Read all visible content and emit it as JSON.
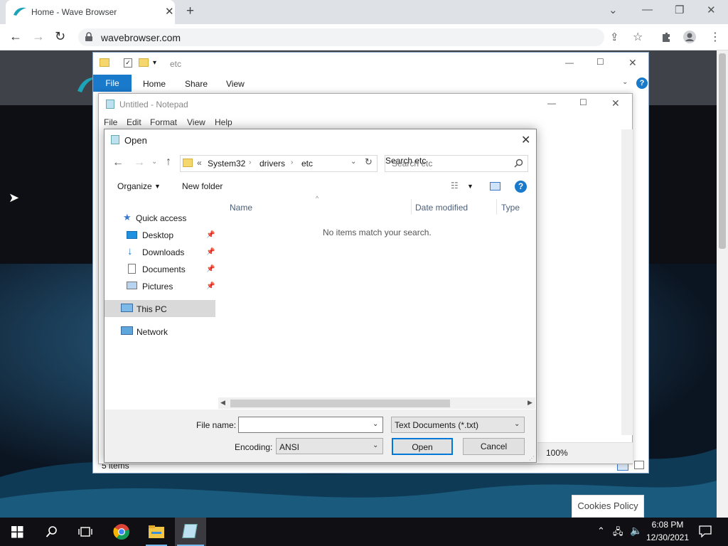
{
  "browser": {
    "tab_title": "Home - Wave Browser",
    "url": "wavebrowser.com"
  },
  "page": {
    "cookies_label": "Cookies Policy"
  },
  "explorer": {
    "title": "etc",
    "ribbon_tabs": [
      "File",
      "Home",
      "Share",
      "View"
    ],
    "status": "5 items"
  },
  "notepad": {
    "title": "Untitled - Notepad",
    "menu": [
      "File",
      "Edit",
      "Format",
      "View",
      "Help"
    ],
    "zoom": "100%"
  },
  "dialog": {
    "title": "Open",
    "breadcrumb": [
      "System32",
      "drivers",
      "etc"
    ],
    "breadcrumb_prefix": "«",
    "search_placeholder": "Search etc",
    "organize_label": "Organize",
    "new_folder_label": "New folder",
    "columns": [
      "Name",
      "Date modified",
      "Type"
    ],
    "empty_message": "No items match your search.",
    "nav": {
      "quick_access": "Quick access",
      "items": [
        "Desktop",
        "Downloads",
        "Documents",
        "Pictures"
      ],
      "this_pc": "This PC",
      "network": "Network"
    },
    "file_name_label": "File name:",
    "file_name_value": "",
    "file_type": "Text Documents (*.txt)",
    "encoding_label": "Encoding:",
    "encoding_value": "ANSI",
    "open_label": "Open",
    "cancel_label": "Cancel"
  },
  "taskbar": {
    "time": "6:08 PM",
    "date": "12/30/2021"
  },
  "colors": {
    "accent": "#0078d7",
    "selection": "#cce8ff",
    "taskbar": "#101014"
  }
}
